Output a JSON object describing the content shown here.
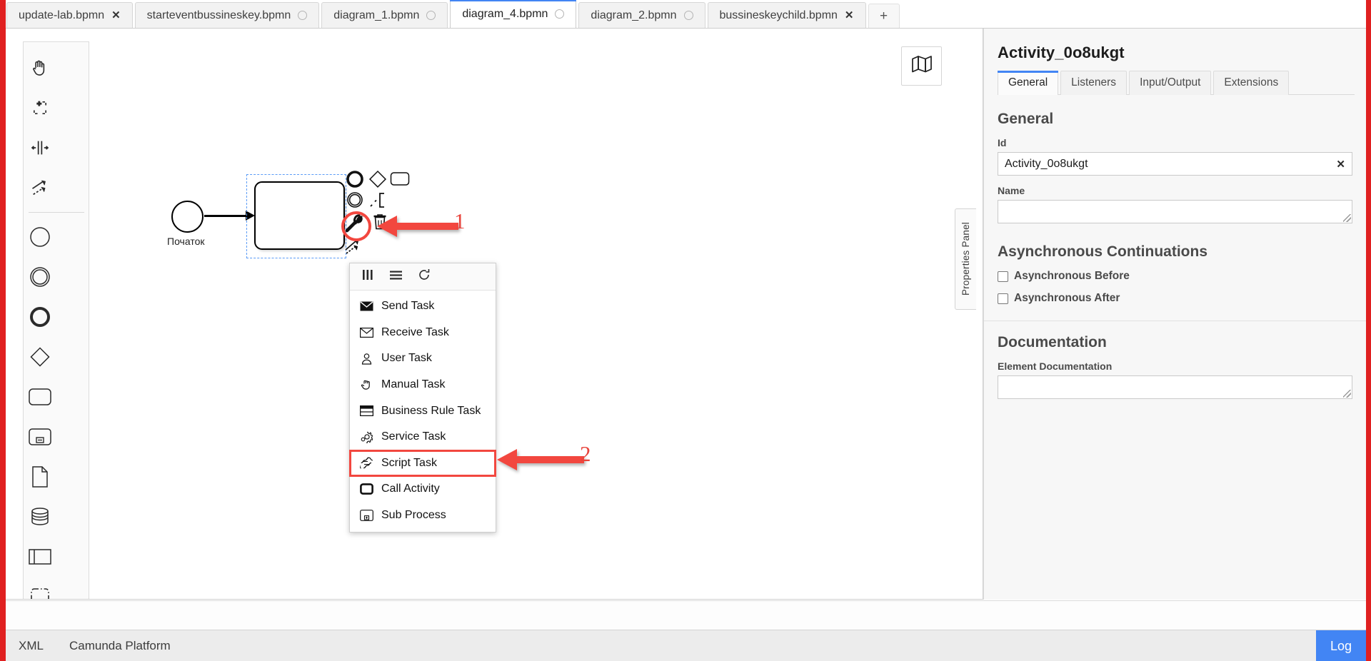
{
  "tabs": [
    {
      "label": "update-lab.bpmn",
      "active": false,
      "indicator": "close"
    },
    {
      "label": "starteventbussineskey.bpmn",
      "active": false,
      "indicator": "dot"
    },
    {
      "label": "diagram_1.bpmn",
      "active": false,
      "indicator": "dot"
    },
    {
      "label": "diagram_4.bpmn",
      "active": true,
      "indicator": "dot"
    },
    {
      "label": "diagram_2.bpmn",
      "active": false,
      "indicator": "dot"
    },
    {
      "label": "bussineskeychild.bpmn",
      "active": false,
      "indicator": "close"
    }
  ],
  "new_tab_label": "+",
  "palette": {
    "items": [
      {
        "name": "hand-tool-icon",
        "title": "Activate the hand tool"
      },
      {
        "name": "lasso-tool-icon",
        "title": "Activate the lasso tool"
      },
      {
        "name": "space-tool-icon",
        "title": "Activate the create/remove space tool"
      },
      {
        "name": "connect-tool-icon",
        "title": "Activate the global connect tool"
      },
      {
        "name": "start-event-icon",
        "title": "Create StartEvent"
      },
      {
        "name": "intermediate-event-icon",
        "title": "Create Intermediate/Boundary Event"
      },
      {
        "name": "end-event-icon",
        "title": "Create EndEvent"
      },
      {
        "name": "gateway-icon",
        "title": "Create Gateway"
      },
      {
        "name": "task-icon",
        "title": "Create Task"
      },
      {
        "name": "data-object-reference-icon",
        "title": "Create DataObjectReference"
      },
      {
        "name": "data-store-reference-icon",
        "title": "Create DataStoreReference"
      },
      {
        "name": "participant-icon",
        "title": "Create Pool/Participant"
      },
      {
        "name": "group-icon",
        "title": "Create Group"
      }
    ]
  },
  "canvas": {
    "minimap_icon": "map-icon",
    "start_event_label": "Початок",
    "task_label": "",
    "context_pad": [
      {
        "name": "append-end-event-icon"
      },
      {
        "name": "append-gateway-icon"
      },
      {
        "name": "append-task-icon"
      },
      {
        "name": "append-intermediate-event-icon"
      },
      {
        "name": "append-text-annotation-icon"
      },
      {
        "name": "change-element-wrench-icon"
      },
      {
        "name": "delete-trash-icon"
      },
      {
        "name": "connect-icon"
      }
    ]
  },
  "replace_menu": {
    "header_icons": [
      {
        "name": "columns-icon"
      },
      {
        "name": "list-icon"
      },
      {
        "name": "loop-icon"
      }
    ],
    "items": [
      {
        "label": "Send Task",
        "icon": "send-task-icon",
        "highlighted": false
      },
      {
        "label": "Receive Task",
        "icon": "receive-task-icon",
        "highlighted": false
      },
      {
        "label": "User Task",
        "icon": "user-task-icon",
        "highlighted": false
      },
      {
        "label": "Manual Task",
        "icon": "manual-task-icon",
        "highlighted": false
      },
      {
        "label": "Business Rule Task",
        "icon": "business-rule-task-icon",
        "highlighted": false
      },
      {
        "label": "Service Task",
        "icon": "service-task-icon",
        "highlighted": false
      },
      {
        "label": "Script Task",
        "icon": "script-task-icon",
        "highlighted": true
      },
      {
        "label": "Call Activity",
        "icon": "call-activity-icon",
        "highlighted": false
      },
      {
        "label": "Sub Process",
        "icon": "sub-process-icon",
        "highlighted": false
      }
    ]
  },
  "annotations": [
    {
      "number": "1",
      "target": "change-element-wrench-icon"
    },
    {
      "number": "2",
      "target": "script-task-menu-item"
    }
  ],
  "properties_panel": {
    "handle_label": "Properties Panel",
    "title": "Activity_0o8ukgt",
    "tabs": [
      {
        "label": "General",
        "active": true
      },
      {
        "label": "Listeners",
        "active": false
      },
      {
        "label": "Input/Output",
        "active": false
      },
      {
        "label": "Extensions",
        "active": false
      }
    ],
    "general": {
      "heading": "General",
      "id_label": "Id",
      "id_value": "Activity_0o8ukgt",
      "id_clear_icon": "✕",
      "name_label": "Name",
      "name_value": "",
      "name_placeholder": ""
    },
    "async": {
      "heading": "Asynchronous Continuations",
      "before_label": "Asynchronous Before",
      "before_checked": false,
      "after_label": "Asynchronous After",
      "after_checked": false
    },
    "documentation": {
      "heading": "Documentation",
      "element_doc_label": "Element Documentation",
      "element_doc_value": ""
    }
  },
  "statusbar": {
    "items": [
      "XML",
      "Camunda Platform"
    ],
    "log_label": "Log"
  },
  "colors": {
    "accent_blue": "#4285f4",
    "annotation_red": "#f2473f",
    "edge_red": "#e02020",
    "panel_bg": "#f7f7f7"
  }
}
